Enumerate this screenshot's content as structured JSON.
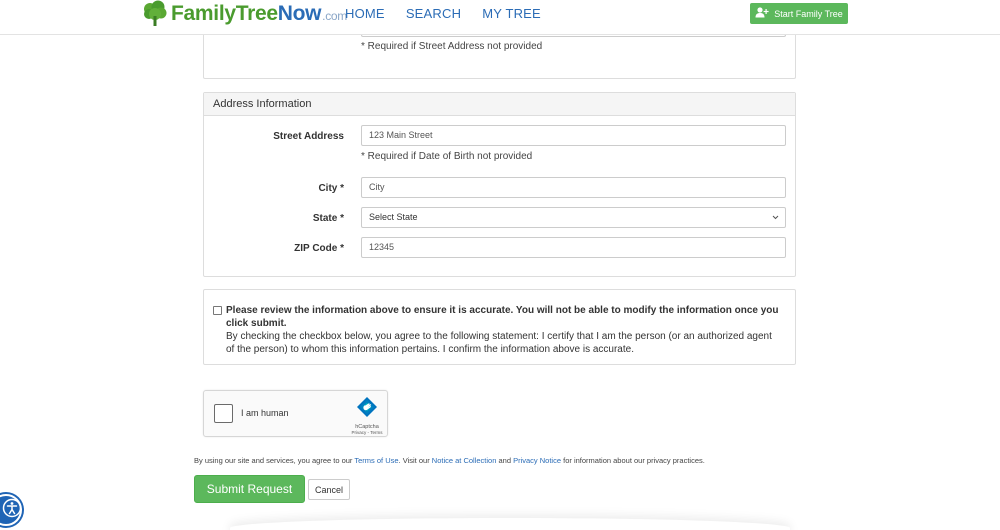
{
  "header": {
    "logo": {
      "family": "Family",
      "tree": "Tree",
      "now": "Now",
      "com": ".com"
    },
    "nav": [
      {
        "label": "HOME"
      },
      {
        "label": "SEARCH"
      },
      {
        "label": "MY TREE"
      }
    ],
    "start_button_label": "Start Family Tree"
  },
  "personal_section": {
    "help_text": "* Required if Street Address not provided"
  },
  "address_section": {
    "heading": "Address Information",
    "street": {
      "label": "Street Address",
      "placeholder": "123 Main Street",
      "help": "* Required if Date of Birth not provided"
    },
    "city": {
      "label": "City *",
      "placeholder": "City"
    },
    "state": {
      "label": "State *",
      "value": "Select State"
    },
    "zip": {
      "label": "ZIP Code *",
      "placeholder": "12345"
    }
  },
  "consent": {
    "bold_text": "Please review the information above to ensure it is accurate. You will not be able to modify the information once you click submit.",
    "text": "By checking the checkbox below, you agree to the following statement: I certify that I am the person (or an authorized agent of the person) to whom this information pertains. I confirm the information above is accurate.",
    "checked": false
  },
  "captcha": {
    "label": "I am human",
    "brand": "hCaptcha",
    "privacy": "Privacy",
    "separator": " - ",
    "terms": "Terms"
  },
  "legal": {
    "prefix": "By using our site and services, you agree to our ",
    "terms_link": "Terms of Use",
    "middle1": ". Visit our ",
    "notice_link": "Notice at Collection",
    "middle2": " and ",
    "privacy_link": "Privacy Notice",
    "suffix": " for information about our privacy practices."
  },
  "buttons": {
    "submit": "Submit Request",
    "cancel": "Cancel"
  },
  "colors": {
    "brand_green": "#5cb85c",
    "link_blue": "#2b6cb6",
    "accessibility_blue": "#1f64b5"
  },
  "icons": {
    "logo": "tree-icon",
    "start_button": "add-user-icon",
    "select": "chevron-down-icon",
    "captcha": "hcaptcha-logo-icon",
    "accessibility": "accessibility-icon"
  }
}
